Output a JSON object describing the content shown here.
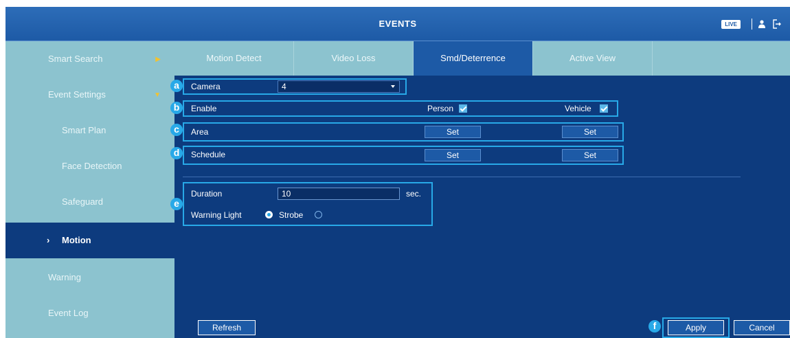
{
  "titlebar": {
    "title": "EVENTS",
    "live_badge": "LIVE"
  },
  "sidebar": {
    "items": [
      {
        "label": "Smart Search",
        "arrow": "▶"
      },
      {
        "label": "Event Settings",
        "arrow": "▼"
      },
      {
        "label": "Smart Plan"
      },
      {
        "label": "Face Detection"
      },
      {
        "label": "Safeguard"
      },
      {
        "label": "Motion",
        "prefix": "›"
      },
      {
        "label": "Warning"
      },
      {
        "label": "Event Log"
      }
    ]
  },
  "tabs": [
    "Motion Detect",
    "Video Loss",
    "Smd/Deterrence",
    "Active View"
  ],
  "form": {
    "markers": [
      "a",
      "b",
      "c",
      "d",
      "e",
      "f"
    ],
    "camera": {
      "label": "Camera",
      "value": "4"
    },
    "enable": {
      "label": "Enable",
      "person_label": "Person",
      "vehicle_label": "Vehicle",
      "person_checked": true,
      "vehicle_checked": true
    },
    "area": {
      "label": "Area",
      "set_label": "Set"
    },
    "schedule": {
      "label": "Schedule",
      "set_label": "Set"
    },
    "duration": {
      "label": "Duration",
      "value": "10",
      "unit": "sec."
    },
    "warning": {
      "label": "Warning Light",
      "strobe_label": "Strobe",
      "warning_selected": true
    }
  },
  "buttons": {
    "refresh": "Refresh",
    "apply": "Apply",
    "cancel": "Cancel"
  },
  "colors": {
    "accent": "#28a9e8",
    "background": "#0d3b7e",
    "sidebar": "#8cc3cf",
    "tab_selected": "#1d5aa6"
  }
}
